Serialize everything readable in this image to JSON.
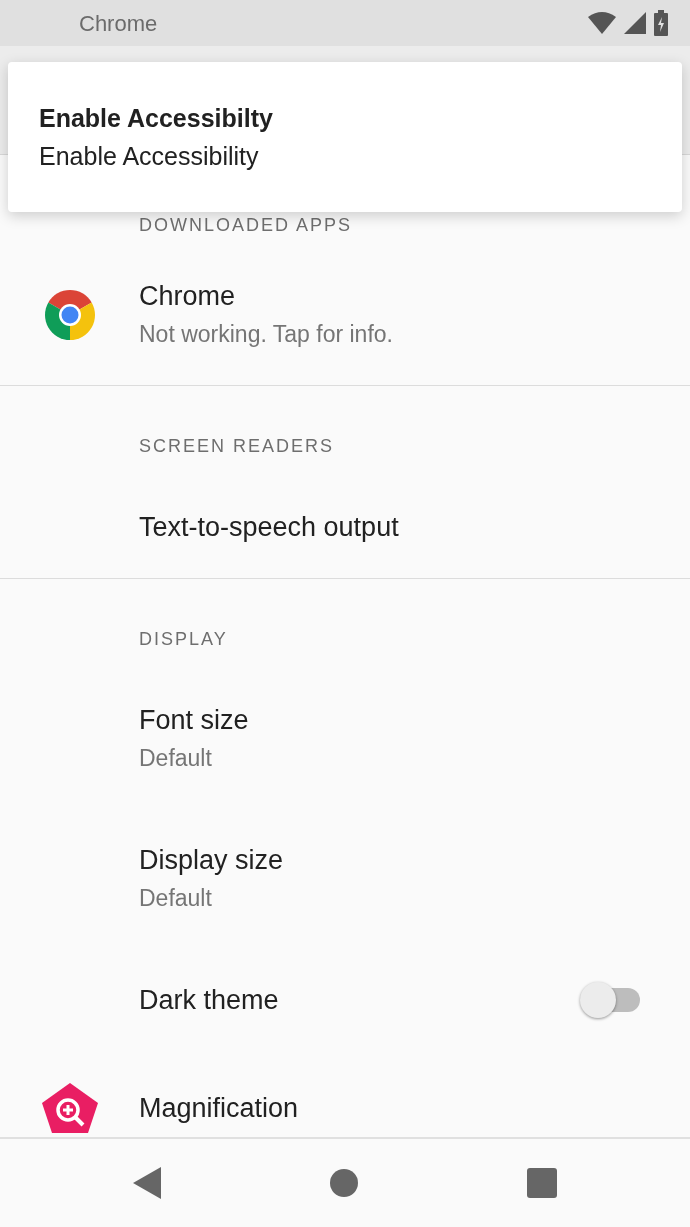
{
  "status_bar": {
    "app_label": "Chrome"
  },
  "notification": {
    "title": "Enable Accessibilty",
    "text": "Enable Accessibility"
  },
  "sections": [
    {
      "header": "DOWNLOADED APPS",
      "items": [
        {
          "kind": "app",
          "title": "Chrome",
          "summary": "Not working. Tap for info."
        }
      ]
    },
    {
      "header": "SCREEN READERS",
      "items": [
        {
          "kind": "plain",
          "title": "Text-to-speech output"
        }
      ]
    },
    {
      "header": "DISPLAY",
      "items": [
        {
          "kind": "plain",
          "title": "Font size",
          "summary": "Default"
        },
        {
          "kind": "plain",
          "title": "Display size",
          "summary": "Default"
        },
        {
          "kind": "switch",
          "title": "Dark theme",
          "on": false
        },
        {
          "kind": "magnifier",
          "title": "Magnification"
        }
      ]
    }
  ]
}
